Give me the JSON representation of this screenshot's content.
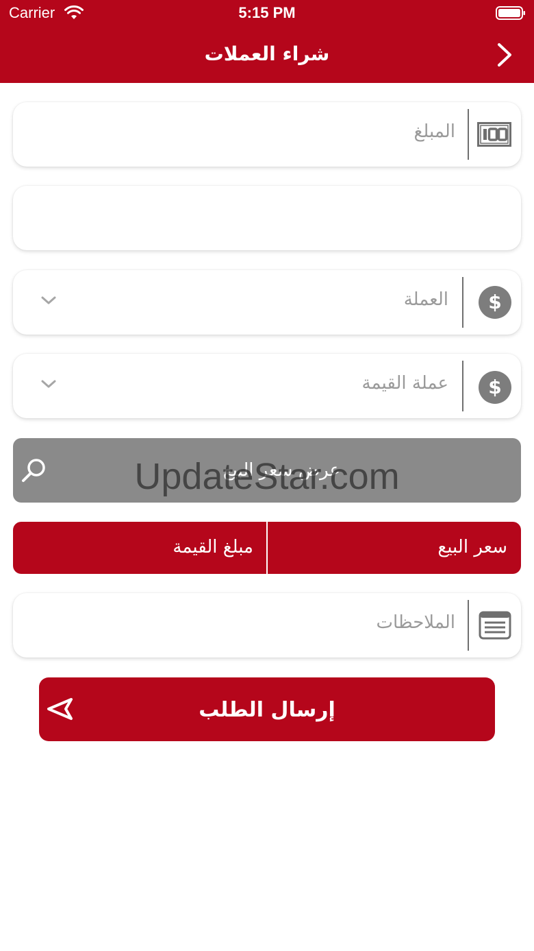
{
  "status_bar": {
    "carrier": "Carrier",
    "time": "5:15 PM"
  },
  "header": {
    "title": "شراء العملات",
    "back_icon": "chevron-right-icon"
  },
  "form": {
    "amount_placeholder": "المبلغ",
    "amount_icon": "cash-icon",
    "empty_field_value": "",
    "currency_placeholder": "العملة",
    "currency_icon": "dollar-icon",
    "value_currency_placeholder": "عملة القيمة",
    "value_currency_icon": "dollar-icon",
    "show_rate_label": "عرض سعر البيع",
    "selling_price_label": "سعر البيع",
    "value_amount_label": "مبلغ القيمة",
    "notes_placeholder": "الملاحظات",
    "notes_icon": "notes-icon",
    "submit_label": "إرسال الطلب"
  },
  "watermark": "UpdateStar.com",
  "colors": {
    "brand_red": "#b5061b",
    "gray_button": "#8a8a8a",
    "icon_gray": "#7d7d7d"
  }
}
